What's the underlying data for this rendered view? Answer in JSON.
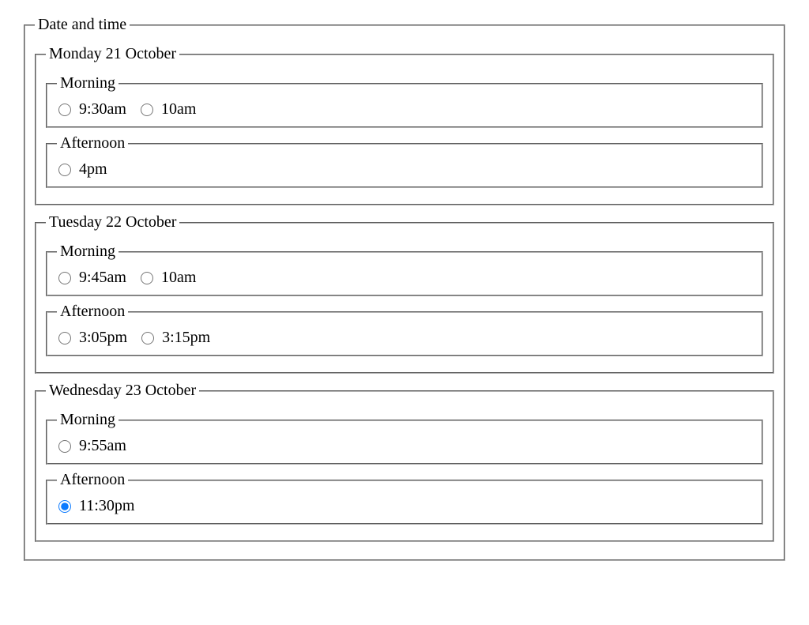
{
  "form": {
    "legend": "Date and time",
    "selected": "2-1-0",
    "days": [
      {
        "legend": "Monday 21 October",
        "periods": [
          {
            "legend": "Morning",
            "slots": [
              "9:30am",
              "10am"
            ]
          },
          {
            "legend": "Afternoon",
            "slots": [
              "4pm"
            ]
          }
        ]
      },
      {
        "legend": "Tuesday 22 October",
        "periods": [
          {
            "legend": "Morning",
            "slots": [
              "9:45am",
              "10am"
            ]
          },
          {
            "legend": "Afternoon",
            "slots": [
              "3:05pm",
              "3:15pm"
            ]
          }
        ]
      },
      {
        "legend": "Wednesday 23 October",
        "periods": [
          {
            "legend": "Morning",
            "slots": [
              "9:55am"
            ]
          },
          {
            "legend": "Afternoon",
            "slots": [
              "11:30pm"
            ]
          }
        ]
      }
    ]
  }
}
